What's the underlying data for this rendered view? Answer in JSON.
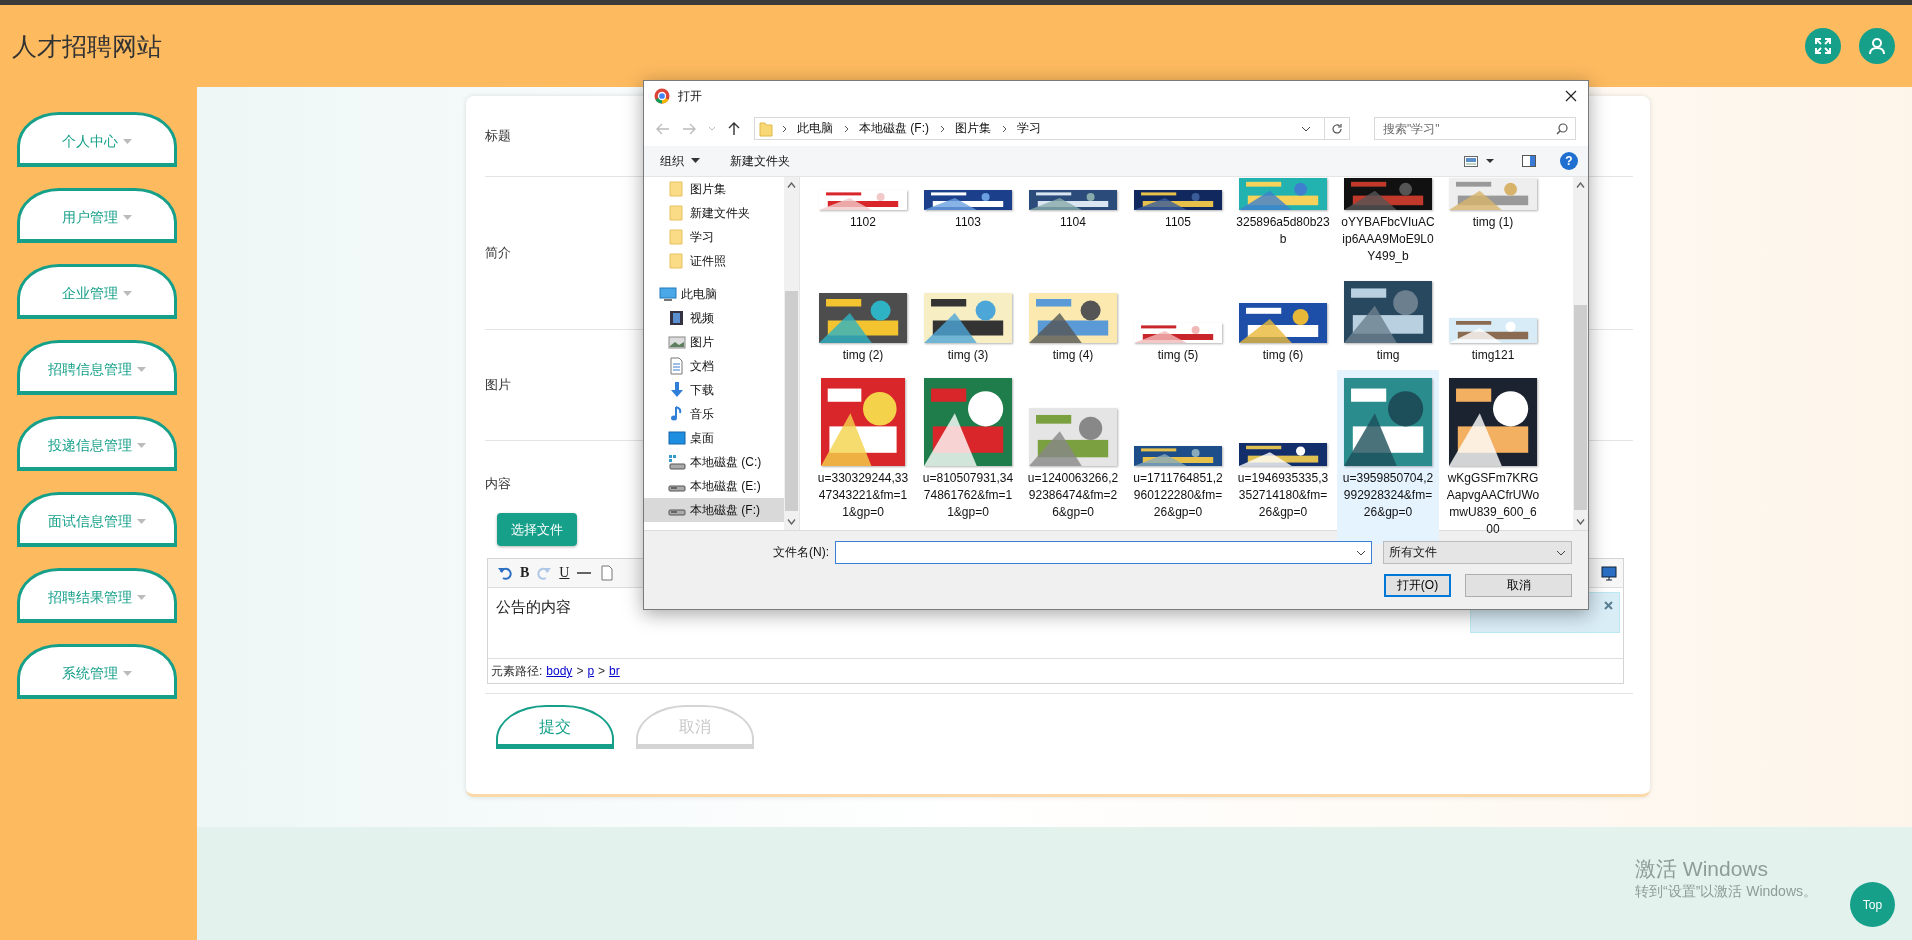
{
  "header": {
    "title": "人才招聘网站"
  },
  "sidebar": {
    "items": [
      {
        "label": "个人中心"
      },
      {
        "label": "用户管理"
      },
      {
        "label": "企业管理"
      },
      {
        "label": "招聘信息管理"
      },
      {
        "label": "投递信息管理"
      },
      {
        "label": "面试信息管理"
      },
      {
        "label": "招聘结果管理"
      },
      {
        "label": "系统管理"
      }
    ]
  },
  "form": {
    "fields": [
      {
        "label": "标题"
      },
      {
        "label": "简介"
      },
      {
        "label": "图片"
      },
      {
        "label": "内容"
      }
    ],
    "upload_button": "选择文件",
    "editor": {
      "toolbar": [
        {
          "kind": "undo",
          "disabled": false
        },
        {
          "kind": "bold",
          "label": "B",
          "disabled": false
        },
        {
          "kind": "redo",
          "disabled": true
        },
        {
          "kind": "underline",
          "label": "U",
          "disabled": false
        },
        {
          "kind": "rule",
          "disabled": false
        },
        {
          "kind": "page",
          "disabled": false
        },
        {
          "kind": "monitor",
          "disabled": false
        }
      ],
      "content": "公告的内容",
      "path_label": "元素路径:",
      "path": [
        "body",
        "p",
        "br"
      ],
      "separator": ">"
    },
    "buttons": [
      {
        "label": "提交",
        "kind": "primary"
      },
      {
        "label": "取消",
        "kind": "secondary"
      }
    ]
  },
  "dialog": {
    "title": "打开",
    "breadcrumbs": [
      "此电脑",
      "本地磁盘 (F:)",
      "图片集",
      "学习"
    ],
    "search": {
      "placeholder": "搜索\"学习\""
    },
    "toolbar": {
      "organize": "组织",
      "new_folder": "新建文件夹",
      "help": "?"
    },
    "tree": [
      {
        "label": "图片集",
        "kind": "folder",
        "selected": false
      },
      {
        "label": "新建文件夹",
        "kind": "folder",
        "selected": false
      },
      {
        "label": "学习",
        "kind": "folder",
        "selected": false
      },
      {
        "label": "证件照",
        "kind": "folder",
        "selected": false
      },
      {
        "label": "此电脑",
        "kind": "pc",
        "selected": false,
        "children": [
          {
            "label": "视频",
            "kind": "video",
            "selected": false
          },
          {
            "label": "图片",
            "kind": "pictures",
            "selected": false
          },
          {
            "label": "文档",
            "kind": "document",
            "selected": false
          },
          {
            "label": "下载",
            "kind": "download",
            "selected": false
          },
          {
            "label": "音乐",
            "kind": "music",
            "selected": false
          },
          {
            "label": "桌面",
            "kind": "desktop",
            "selected": false
          },
          {
            "label": "本地磁盘 (C:)",
            "kind": "system-drive",
            "selected": false
          },
          {
            "label": "本地磁盘 (E:)",
            "kind": "drive",
            "selected": false
          },
          {
            "label": "本地磁盘 (F:)",
            "kind": "drive",
            "selected": true
          }
        ]
      }
    ],
    "files": [
      {
        "name": "1102",
        "selected": false
      },
      {
        "name": "1103",
        "selected": false
      },
      {
        "name": "1104",
        "selected": false
      },
      {
        "name": "1105",
        "selected": false
      },
      {
        "name": "325896a5d80b23b",
        "selected": false
      },
      {
        "name": "oYYBAFbcVIuACip6AAA9MoE9L0Y499_b",
        "selected": false
      },
      {
        "name": "timg (1)",
        "selected": false
      },
      {
        "name": "timg (2)",
        "selected": false
      },
      {
        "name": "timg (3)",
        "selected": false
      },
      {
        "name": "timg (4)",
        "selected": false
      },
      {
        "name": "timg (5)",
        "selected": false
      },
      {
        "name": "timg (6)",
        "selected": false
      },
      {
        "name": "timg",
        "selected": false
      },
      {
        "name": "timg121",
        "selected": false
      },
      {
        "name": "u=330329244,3347343221&fm=11&gp=0",
        "selected": false
      },
      {
        "name": "u=810507931,3474861762&fm=11&gp=0",
        "selected": false
      },
      {
        "name": "u=1240063266,292386474&fm=26&gp=0",
        "selected": false
      },
      {
        "name": "u=1711764851,2960122280&fm=26&gp=0",
        "selected": false
      },
      {
        "name": "u=1946935335,3352714180&fm=26&gp=0",
        "selected": false
      },
      {
        "name": "u=3959850704,2992928324&fm=26&gp=0",
        "selected": true
      },
      {
        "name": "wKgGSFm7KRGAapvgAACfrUWomwU839_600_600",
        "selected": false
      }
    ],
    "file_name_label": "文件名(N):",
    "file_type": "所有文件",
    "buttons": [
      {
        "label": "打开(O)",
        "kind": "primary"
      },
      {
        "label": "取消",
        "kind": "secondary"
      }
    ]
  },
  "activation": {
    "title": "激活 Windows",
    "text": "转到“设置”以激活 Windows。"
  },
  "top_button": "Top"
}
